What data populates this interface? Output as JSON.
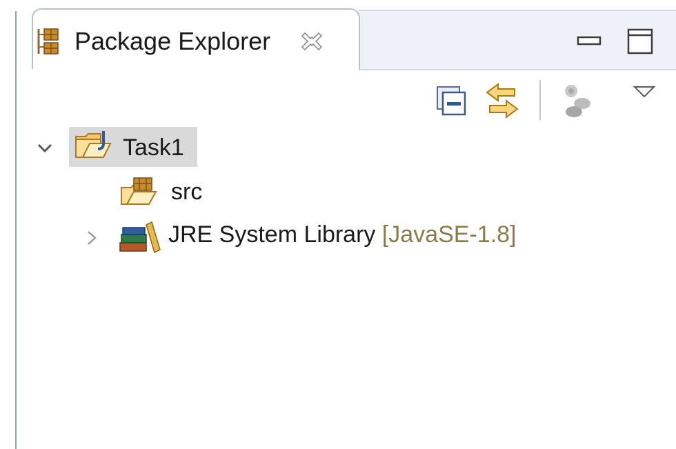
{
  "view": {
    "tab_title": "Package Explorer",
    "icon": "package-explorer-icon",
    "close_icon": "close-icon",
    "minimize_icon": "minimize-icon",
    "maximize_icon": "maximize-icon"
  },
  "toolbar": {
    "items": [
      {
        "name": "collapse-all-icon"
      },
      {
        "name": "link-with-editor-icon"
      },
      {
        "name": "focus-on-active-task-icon"
      },
      {
        "name": "view-menu-icon"
      }
    ]
  },
  "tree": {
    "nodes": [
      {
        "label": "Task1",
        "icon": "java-project-icon",
        "expanded": true,
        "selected": true
      },
      {
        "label": "src",
        "icon": "source-folder-icon"
      },
      {
        "label": "JRE System Library",
        "decoration": " [JavaSE-1.8]",
        "icon": "library-icon",
        "expanded": false
      }
    ]
  },
  "colors": {
    "selection": "#d9d9d9",
    "decoration_text": "#8c7b4a",
    "tab_border": "#b7c0cc",
    "tab_strip": "#eef2f8"
  }
}
